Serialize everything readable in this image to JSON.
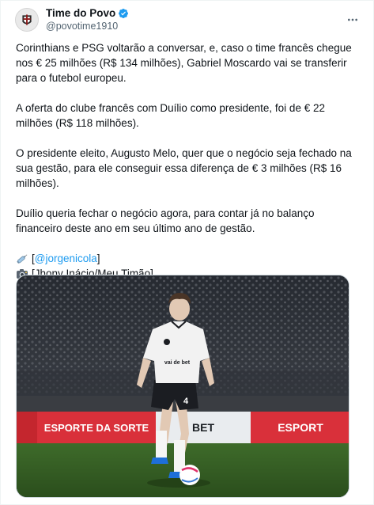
{
  "author": {
    "display_name": "Time do Povo",
    "handle": "@povotime1910",
    "verified": true,
    "verified_color": "#1d9bf0",
    "avatar_icon": "team-crest-avatar"
  },
  "menu": {
    "icon": "more-options-icon"
  },
  "post": {
    "paragraphs": [
      "Corinthians e PSG voltarão a conversar, e, caso o time francês chegue nos € 25 milhões (R$ 134 milhões), Gabriel Moscardo vai se transferir para o futebol europeu.",
      "A oferta do clube francês com Duílio como presidente, foi de € 22 milhões (R$ 118 milhões).",
      "O presidente eleito, Augusto Melo, quer que o negócio seja fechado na sua gestão, para ele conseguir essa diferença de € 3 milhões (R$ 16 milhões).",
      "Duílio queria fechar o negócio agora, para contar já no balanço financeiro deste ano em seu último ano de gestão."
    ],
    "source_prefix": "[",
    "source_link": "@jorgenicola",
    "source_suffix": "]",
    "source_icon": "syringe-icon",
    "photo_credit": "[Jhony Inácio/Meu Timão]",
    "photo_icon": "camera-icon"
  },
  "media": {
    "player_number": "4",
    "sponsor_text": "vai de bet",
    "board_left": "ESPORTE DA SORTE",
    "board_mid": "BET",
    "board_right": "ESPORT"
  },
  "colors": {
    "link": "#1d9bf0",
    "text": "#0f1419",
    "secondary": "#536471"
  }
}
